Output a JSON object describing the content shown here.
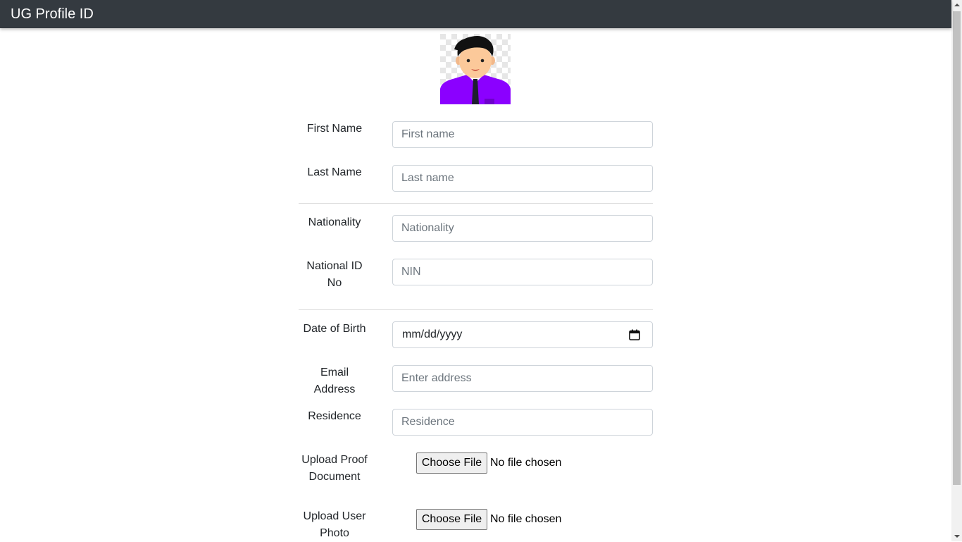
{
  "navbar": {
    "brand": "UG Profile ID",
    "bg_color": "#343a40"
  },
  "avatar": {
    "icon": "user-avatar-icon",
    "shirt_color": "#8b00ff"
  },
  "form": {
    "first_name": {
      "label": "First Name",
      "placeholder": "First name",
      "value": ""
    },
    "last_name": {
      "label": "Last Name",
      "placeholder": "Last name",
      "value": ""
    },
    "nationality": {
      "label": "Nationality",
      "placeholder": "Nationality",
      "value": ""
    },
    "national_id": {
      "label": "National ID No",
      "placeholder": "NIN",
      "value": ""
    },
    "dob": {
      "label": "Date of Birth",
      "format": "mm/dd/yyyy",
      "icon": "calendar-icon"
    },
    "email": {
      "label": "Email Address",
      "placeholder": "Enter address",
      "value": ""
    },
    "residence": {
      "label": "Residence",
      "placeholder": "Residence",
      "value": ""
    },
    "proof_document": {
      "label": "Upload Proof Document",
      "button": "Choose File",
      "status": "No file chosen"
    },
    "user_photo": {
      "label": "Upload User Photo",
      "button": "Choose File",
      "status": "No file chosen"
    }
  }
}
